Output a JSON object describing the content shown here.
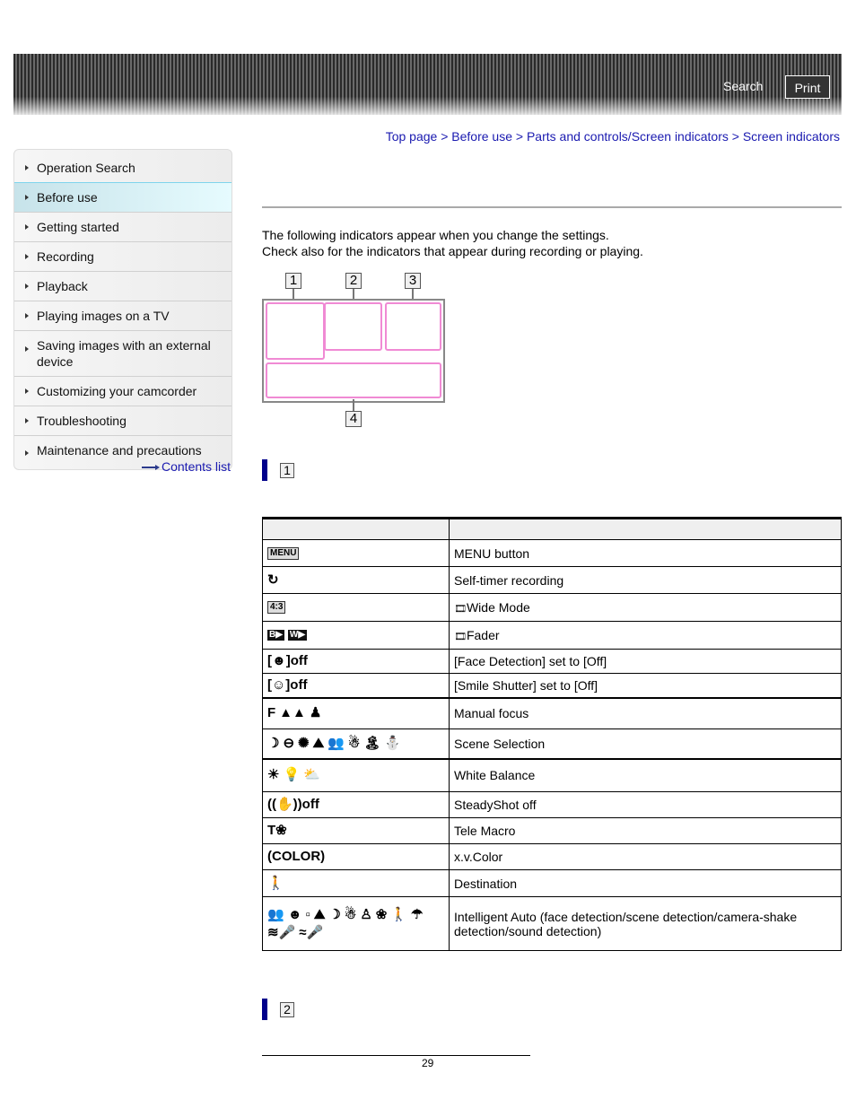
{
  "header": {
    "search_label": "Search",
    "print_label": "Print"
  },
  "breadcrumb": [
    {
      "label": "Top page"
    },
    {
      "label": "Before use"
    },
    {
      "label": "Parts and controls/Screen indicators"
    },
    {
      "label": "Screen indicators"
    }
  ],
  "breadcrumb_separator": ">",
  "sidebar": {
    "items": [
      {
        "label": "Operation Search",
        "active": false
      },
      {
        "label": "Before use",
        "active": true
      },
      {
        "label": "Getting started",
        "active": false
      },
      {
        "label": "Recording",
        "active": false
      },
      {
        "label": "Playback",
        "active": false
      },
      {
        "label": "Playing images on a TV",
        "active": false
      },
      {
        "label": "Saving images with an external device",
        "active": false
      },
      {
        "label": "Customizing your camcorder",
        "active": false
      },
      {
        "label": "Troubleshooting",
        "active": false
      },
      {
        "label": "Maintenance and precautions",
        "active": false
      }
    ],
    "contents_link": "Contents list"
  },
  "intro": {
    "line1": "The following indicators appear when you change the settings.",
    "line2": "Check also for the indicators that appear during recording or playing."
  },
  "diagram": {
    "labels": [
      "1",
      "2",
      "3",
      "4"
    ]
  },
  "sections": [
    {
      "number": "1"
    },
    {
      "number": "2"
    }
  ],
  "table": {
    "headers": [
      "",
      ""
    ],
    "rows": [
      {
        "icons": [
          "MENU"
        ],
        "icon_names": [
          "menu-icon"
        ],
        "description": "MENU button"
      },
      {
        "icons": [
          "↻"
        ],
        "icon_names": [
          "self-timer-icon"
        ],
        "description": "Self-timer recording"
      },
      {
        "icons": [
          "4:3"
        ],
        "icon_names": [
          "aspect-4-3-icon"
        ],
        "description": "Wide Mode",
        "prefix_icon": "movie-film-icon"
      },
      {
        "icons": [
          "B▶",
          "W▶"
        ],
        "icon_names": [
          "fader-black-icon",
          "fader-white-icon"
        ],
        "description": "Fader",
        "prefix_icon": "movie-film-icon"
      },
      {
        "icons": [
          "[☻]off"
        ],
        "icon_names": [
          "face-detection-off-icon"
        ],
        "description": "[Face Detection] set to [Off]"
      },
      {
        "icons": [
          "[☺]off"
        ],
        "icon_names": [
          "smile-shutter-off-icon"
        ],
        "description": "[Smile Shutter] set to [Off]"
      },
      {
        "icons": [
          "F",
          "▲▲",
          "♟"
        ],
        "icon_names": [
          "manual-focus-icon",
          "focus-infinity-icon",
          "focus-near-icon"
        ],
        "description": "Manual focus"
      },
      {
        "icons": [
          "☽",
          "⊖",
          "✺",
          "⛰",
          "👥",
          "☃",
          "🏝",
          "⛄"
        ],
        "icon_names": [
          "night-scene-icon",
          "sunrise-sunset-icon",
          "fireworks-icon",
          "landscape-icon",
          "portrait-icon",
          "spotlight-icon",
          "beach-icon",
          "snow-icon"
        ],
        "description": "Scene Selection"
      },
      {
        "icons": [
          "☀",
          "💡",
          "⛅"
        ],
        "icon_names": [
          "outdoor-icon",
          "indoor-icon",
          "one-push-icon"
        ],
        "description": "White Balance"
      },
      {
        "icons": [
          "((✋))off"
        ],
        "icon_names": [
          "steadyshot-off-icon"
        ],
        "description": "SteadyShot off"
      },
      {
        "icons": [
          "T❀"
        ],
        "icon_names": [
          "tele-macro-icon"
        ],
        "description": "Tele Macro"
      },
      {
        "icons": [
          "(COLOR)"
        ],
        "icon_names": [
          "xv-color-icon"
        ],
        "description": "x.v.Color"
      },
      {
        "icons": [
          "🚶"
        ],
        "icon_names": [
          "destination-icon"
        ],
        "description": "Destination"
      },
      {
        "icons": [
          "👥",
          "☻",
          "▫",
          "⛰",
          "☽",
          "☃",
          "♙",
          "❀",
          "🚶",
          "☂",
          "≋🎤",
          "≈🎤"
        ],
        "icon_names": [
          "ia-portrait-icon",
          "ia-baby-icon",
          "ia-backlight-icon",
          "ia-landscape-icon",
          "ia-twilight-icon",
          "ia-spotlight-icon",
          "ia-low-light-icon",
          "ia-macro-icon",
          "ia-walking-icon",
          "ia-tripod-icon",
          "ia-auto-wind-noise-icon",
          "ia-wind-noise-icon"
        ],
        "description": "Intelligent Auto (face detection/scene detection/camera-shake detection/sound detection)"
      }
    ]
  },
  "footer": {
    "page_number": "29"
  }
}
